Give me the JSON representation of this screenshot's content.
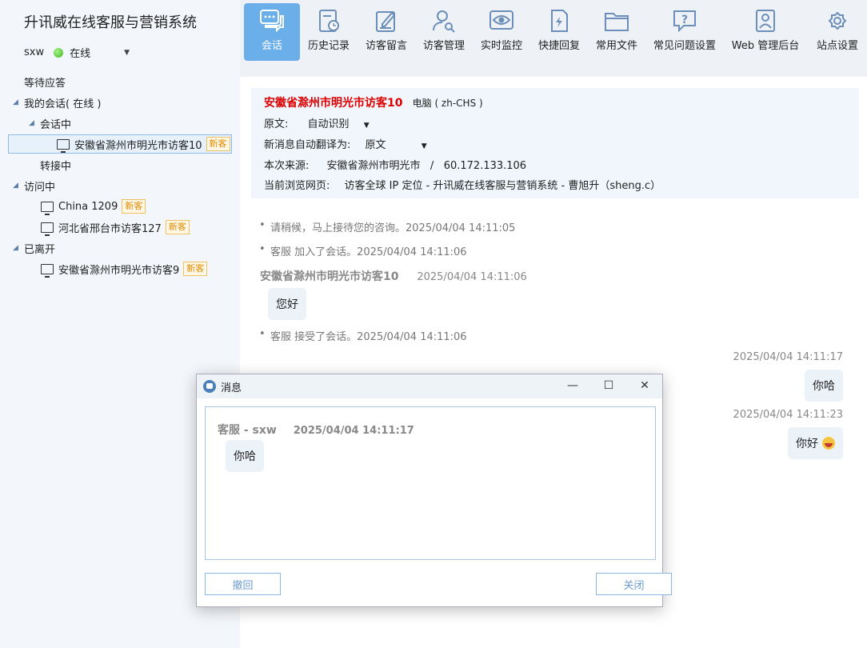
{
  "app": {
    "title": "升讯威在线客服与营销系统",
    "user": "sxw",
    "status": "在线"
  },
  "tree": {
    "waiting": "等待应答",
    "my_sessions": "我的会话( 在线 )",
    "in_session": "会话中",
    "session_item": "安徽省滁州市明光市访客10",
    "transferring": "转接中",
    "visiting": "访问中",
    "visiting_items": [
      "China 1209",
      "河北省邢台市访客127"
    ],
    "left": "已离开",
    "left_items": [
      "安徽省滁州市明光市访客9"
    ],
    "badge": "新客"
  },
  "toolbar": {
    "items": [
      "会话",
      "历史记录",
      "访客留言",
      "访客管理",
      "实时监控",
      "快捷回复",
      "常用文件",
      "常见问题设置",
      "Web 管理后台",
      "站点设置"
    ],
    "active_color": "#6aaeea"
  },
  "visitor_info": {
    "name": "安徽省滁州市明光市访客10",
    "device": "电脑 ( zh-CHS )",
    "orig_label": "原文:",
    "orig_value": "自动识别",
    "translate_label": "新消息自动翻译为:",
    "translate_value": "原文",
    "source_label": "本次来源:",
    "source_value": "安徽省滁州市明光市   /   60.172.133.106",
    "page_label": "当前浏览网页:",
    "page_value": "访客全球 IP 定位 - 升讯威在线客服与营销系统 - 曹旭升（sheng.c）"
  },
  "messages": {
    "sys1": "请稍候，马上接待您的咨询。2025/04/04 14:11:05",
    "sys2": "客服 加入了会话。2025/04/04 14:11:06",
    "visitor_name": "安徽省滁州市明光市访客10",
    "visitor_time": "2025/04/04 14:11:06",
    "visitor_msg": "您好",
    "sys3": "客服 接受了会话。2025/04/04 14:11:06",
    "agent_time1": "2025/04/04 14:11:17",
    "agent_msg1": "你哈",
    "agent_time2": "2025/04/04 14:11:23",
    "agent_msg2": "你好"
  },
  "dialog": {
    "title": "消息",
    "sender": "客服 - sxw",
    "time": "2025/04/04 14:11:17",
    "message": "你哈",
    "recall_button": "撤回",
    "close_button": "关闭"
  }
}
